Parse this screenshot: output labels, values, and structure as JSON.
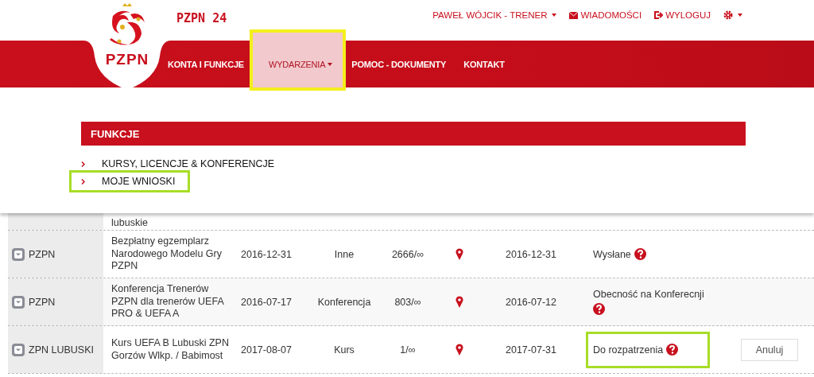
{
  "header": {
    "logo_text": "PZPN",
    "site_title": "PZPN 24",
    "user_menu": [
      {
        "kind": "dropdown",
        "label": "PAWEŁ WÓJCIK - TRENER"
      },
      {
        "kind": "mail",
        "label": "WIADOMOŚCI"
      },
      {
        "kind": "logout",
        "label": "WYLOGUJ"
      },
      {
        "kind": "settings"
      }
    ]
  },
  "nav": [
    {
      "label": "KONTA I FUNKCJE",
      "selected": false,
      "dropdown": false,
      "highlighted": false
    },
    {
      "label": "WYDARZENIA",
      "selected": true,
      "dropdown": true,
      "highlighted": true
    },
    {
      "label": "POMOC - DOKUMENTY",
      "selected": false,
      "dropdown": false,
      "highlighted": false
    },
    {
      "label": "KONTAKT",
      "selected": false,
      "dropdown": false,
      "highlighted": false
    }
  ],
  "dropdown": {
    "heading": "FUNKCJE",
    "items": [
      {
        "label": "KURSY, LICENCJE & KONFERENCJE",
        "highlighted": false
      },
      {
        "label": "MOJE WNIOSKI",
        "highlighted": true
      }
    ]
  },
  "table": {
    "rows": [
      {
        "kind": "partial",
        "event": "lubuskie"
      },
      {
        "kind": "full",
        "org": "PZPN",
        "event": "Bezpłatny egzemplarz Narodowego Modelu Gry PZPN",
        "date": "2016-12-31",
        "type": "Inne",
        "count": "2666/∞",
        "deadline": "2016-12-31",
        "status": "Wysłane",
        "status_highlighted": false
      },
      {
        "kind": "full",
        "org": "PZPN",
        "event": "Konferencja Trenerów PZPN dla trenerów UEFA PRO & UEFA A",
        "date": "2016-07-17",
        "type": "Konferencja",
        "count": "803/∞",
        "deadline": "2016-07-12",
        "status": "Obecność na Konferecnji",
        "status_highlighted": false
      },
      {
        "kind": "full",
        "org": "ZPN LUBUSKI",
        "event": "Kurs UEFA B Lubuski ZPN Gorzów Wlkp. / Babimost",
        "date": "2017-08-07",
        "type": "Kurs",
        "count": "1/∞",
        "deadline": "2017-07-31",
        "status": "Do rozpatrzenia",
        "status_highlighted": true,
        "button": "Anuluj"
      }
    ]
  }
}
